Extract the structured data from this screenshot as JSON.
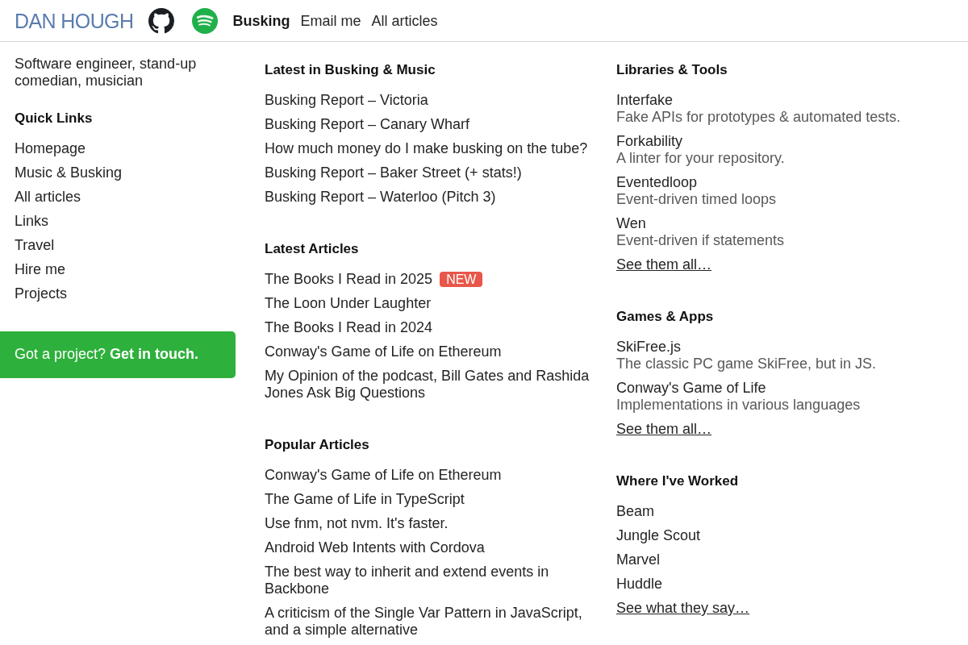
{
  "header": {
    "logo": "DAN HOUGH",
    "nav": [
      {
        "label": "Busking",
        "selected": true
      },
      {
        "label": "Email me",
        "selected": false
      },
      {
        "label": "All articles",
        "selected": false
      }
    ]
  },
  "sidebar": {
    "tagline": "Software engineer, stand-up comedian, musician",
    "quick_links": {
      "title": "Quick Links",
      "items": [
        "Homepage",
        "Music & Busking",
        "All articles",
        "Links",
        "Travel",
        "Hire me",
        "Projects"
      ]
    },
    "cta": "Got a project? **Get in touch.**"
  },
  "articles": [
    {
      "title": "Latest in Busking & Music",
      "items": [
        {
          "label": "Busking Report – Victoria"
        },
        {
          "label": "Busking Report – Canary Wharf"
        },
        {
          "label": "How much money do I make busking on the tube?"
        },
        {
          "label": "Busking Report – Baker Street (+ stats!)"
        },
        {
          "label": "Busking Report – Waterloo (Pitch 3)"
        }
      ]
    },
    {
      "title": "Latest Articles",
      "items": [
        {
          "label": "The Books I Read in 2025",
          "badge": "NEW"
        },
        {
          "label": "The Loon Under Laughter"
        },
        {
          "label": "The Books I Read in 2024"
        },
        {
          "label": "Conway's Game of Life on Ethereum"
        },
        {
          "label": "My Opinion of the podcast, Bill Gates and Rashida Jones Ask Big Questions"
        }
      ]
    },
    {
      "title": "Popular Articles",
      "items": [
        {
          "label": "Conway's Game of Life on Ethereum"
        },
        {
          "label": "The Game of Life in TypeScript"
        },
        {
          "label": "Use fnm, not nvm. It's faster."
        },
        {
          "label": "Android Web Intents with Cordova"
        },
        {
          "label": "The best way to inherit and extend events in Backbone"
        },
        {
          "label": "A criticism of the Single Var Pattern in JavaScript, and a simple alternative"
        }
      ]
    }
  ],
  "projects": [
    {
      "title": "Libraries & Tools",
      "kind": "projects",
      "items": [
        {
          "name": "Interfake",
          "description": "Fake APIs for prototypes & automated tests."
        },
        {
          "name": "Forkability",
          "description": "A linter for your repository."
        },
        {
          "name": "Eventedloop",
          "description": "Event-driven timed loops"
        },
        {
          "name": "Wen",
          "description": "Event-driven if statements"
        }
      ],
      "more": "See them all…"
    },
    {
      "title": "Games & Apps",
      "kind": "projects",
      "items": [
        {
          "name": "SkiFree.js",
          "description": "The classic PC game SkiFree, but in JS."
        },
        {
          "name": "Conway's Game of Life",
          "description": "Implementations in various languages"
        }
      ],
      "more": "See them all…"
    },
    {
      "title": "Where I've Worked",
      "kind": "workplaces",
      "items": [
        {
          "name": "Beam"
        },
        {
          "name": "Jungle Scout"
        },
        {
          "name": "Marvel"
        },
        {
          "name": "Huddle"
        }
      ],
      "more": "See what they say…"
    }
  ]
}
